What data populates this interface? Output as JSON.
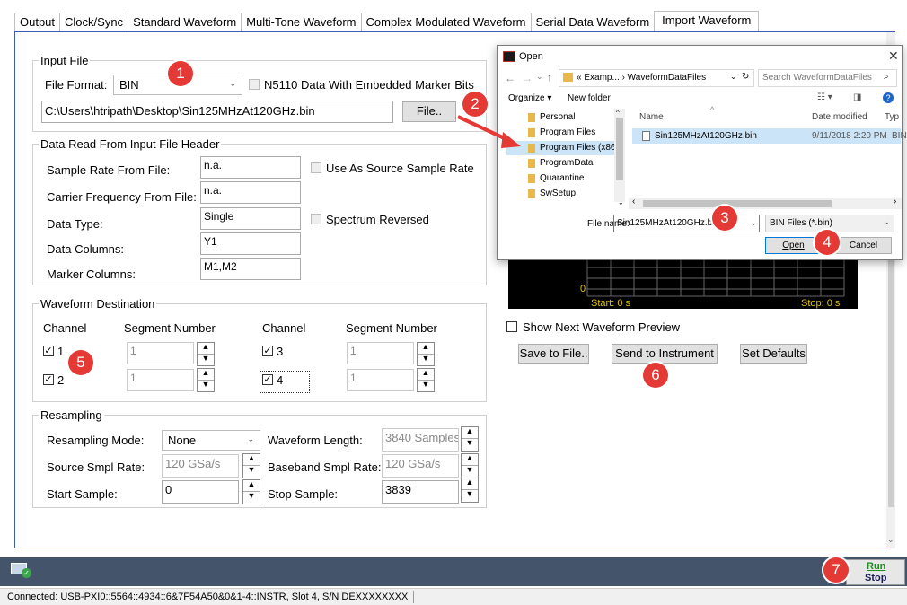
{
  "tabs": [
    "Output",
    "Clock/Sync",
    "Standard Waveform",
    "Multi-Tone Waveform",
    "Complex Modulated Waveform",
    "Serial Data Waveform",
    "Import Waveform"
  ],
  "input_file": {
    "legend": "Input File",
    "format_label": "File Format:",
    "format_value": "BIN",
    "n5110_label": "N5110 Data With Embedded Marker Bits",
    "path": "C:\\Users\\htripath\\Desktop\\Sin125MHzAt120GHz.bin",
    "file_button": "File.."
  },
  "header": {
    "legend": "Data Read From Input File Header",
    "sample_rate_label": "Sample Rate From File:",
    "sample_rate_value": "n.a.",
    "use_source_label": "Use As Source Sample Rate",
    "carrier_label": "Carrier Frequency From File:",
    "carrier_value": "n.a.",
    "data_type_label": "Data Type:",
    "data_type_value": "Single",
    "spectrum_label": "Spectrum Reversed",
    "data_columns_label": "Data Columns:",
    "data_columns_value": "Y1",
    "marker_columns_label": "Marker Columns:",
    "marker_columns_value": "M1,M2"
  },
  "destination": {
    "legend": "Waveform Destination",
    "channel_header": "Channel",
    "segment_header": "Segment Number",
    "channels": [
      {
        "label": "1",
        "segment": "1"
      },
      {
        "label": "2",
        "segment": "1"
      },
      {
        "label": "3",
        "segment": "1"
      },
      {
        "label": "4",
        "segment": "1"
      }
    ]
  },
  "resampling": {
    "legend": "Resampling",
    "mode_label": "Resampling Mode:",
    "mode_value": "None",
    "wave_len_label": "Waveform Length:",
    "wave_len_value": "3840 Samples",
    "source_rate_label": "Source Smpl Rate:",
    "source_rate_value": "120 GSa/s",
    "baseband_label": "Baseband Smpl Rate:",
    "baseband_value": "120 GSa/s",
    "start_label": "Start Sample:",
    "start_value": "0",
    "stop_label": "Stop Sample:",
    "stop_value": "3839"
  },
  "preview": {
    "zero": "0",
    "start": "Start: 0  s",
    "stop": "Stop: 0  s",
    "show_next": "Show Next Waveform Preview",
    "save_button": "Save to File..",
    "send_button": "Send to Instrument",
    "defaults_button": "Set Defaults"
  },
  "dialog": {
    "title": "Open",
    "breadcrumb": "« Examp... › WaveformDataFiles",
    "search_placeholder": "Search WaveformDataFiles",
    "organize": "Organize ▾",
    "new_folder": "New folder",
    "folders": [
      "Personal",
      "Program Files",
      "Program Files (x86)",
      "ProgramData",
      "Quarantine",
      "SwSetup"
    ],
    "col_name": "Name",
    "col_date": "Date modified",
    "col_type": "Typ",
    "file_name": "Sin125MHzAt120GHz.bin",
    "file_date": "9/11/2018 2:20 PM",
    "file_type": "BIN",
    "filename_label": "File name:",
    "filename_value": "Sin125MHzAt120GHz.bin",
    "filter_value": "BIN Files (*.bin)",
    "open_button": "Open",
    "cancel_button": "Cancel"
  },
  "run_stop": {
    "run": "Run",
    "stop": "Stop"
  },
  "status": "Connected: USB-PXI0::5564::4934::6&7F54A50&0&1-4::INSTR, Slot 4, S/N DEXXXXXXXX",
  "badges": [
    "1",
    "2",
    "3",
    "4",
    "5",
    "6",
    "7"
  ]
}
